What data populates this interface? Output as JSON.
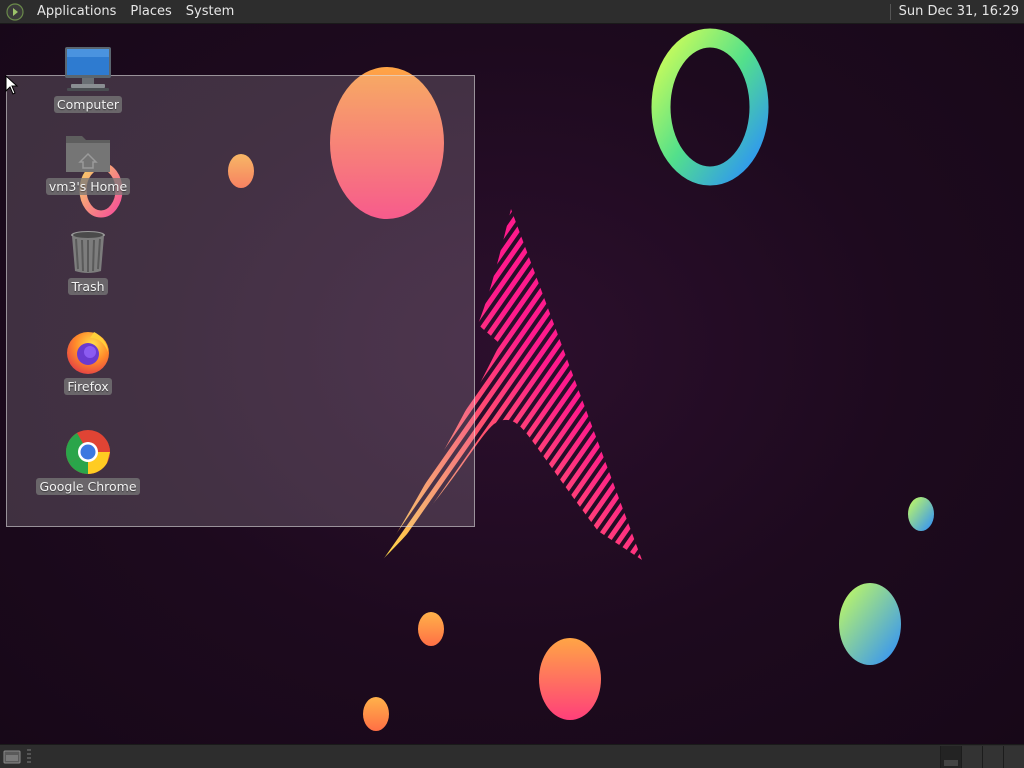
{
  "top_panel": {
    "menus": [
      {
        "label": "Applications"
      },
      {
        "label": "Places"
      },
      {
        "label": "System"
      }
    ],
    "clock": "Sun Dec 31, 16:29",
    "logo_icon": "mate-logo-icon"
  },
  "desktop": {
    "icons": [
      {
        "label": "Computer",
        "icon": "computer-icon"
      },
      {
        "label": "vm3's Home",
        "icon": "home-folder-icon"
      },
      {
        "label": "Trash",
        "icon": "trash-icon"
      },
      {
        "label": "Firefox",
        "icon": "firefox-icon"
      },
      {
        "label": "Google Chrome",
        "icon": "chrome-icon"
      }
    ]
  },
  "bottom_panel": {
    "show_desktop_icon": "show-desktop-icon",
    "workspace_count": 4,
    "active_workspace": 1
  },
  "colors": {
    "panel_bg": "#2d2d2d",
    "panel_text": "#e6e6e6",
    "wallpaper_bg": "#1d0a1e",
    "accent_pink": "#ff1a8c"
  }
}
